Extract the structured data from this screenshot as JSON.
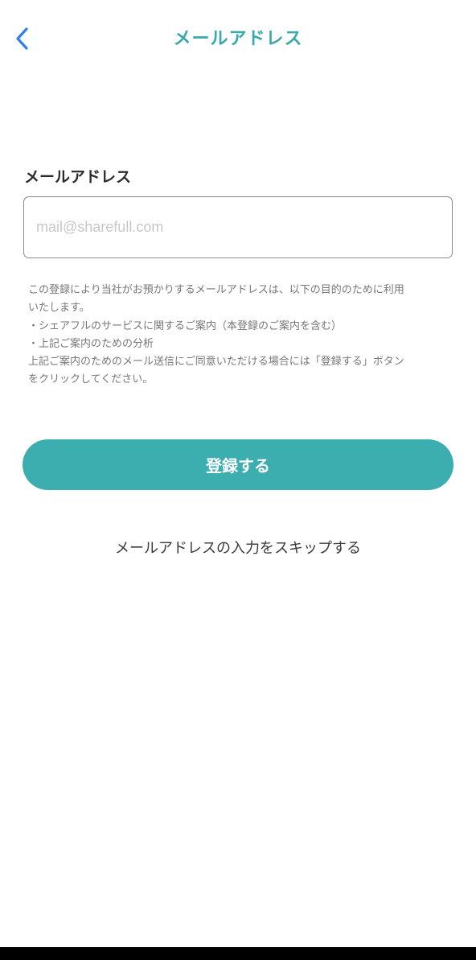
{
  "header": {
    "title": "メールアドレス",
    "back_icon": "chevron-left-icon",
    "accent_color": "#3aa9ac",
    "back_color": "#2f80ed"
  },
  "form": {
    "email_label": "メールアドレス",
    "email_value": "",
    "email_placeholder": "mail@sharefull.com"
  },
  "notice": {
    "lines": [
      "この登録により当社がお預かりするメールアドレスは、以下の目的のために利用",
      "いたします。",
      "・シェアフルのサービスに関するご案内（本登録のご案内を含む）",
      "・上記ご案内のための分析",
      "上記ご案内のためのメール送信にご同意いただける場合には「登録する」ボタン",
      "をクリックしてください。"
    ]
  },
  "actions": {
    "register_label": "登録する",
    "register_color": "#3daeb0",
    "skip_label": "メールアドレスの入力をスキップする"
  }
}
